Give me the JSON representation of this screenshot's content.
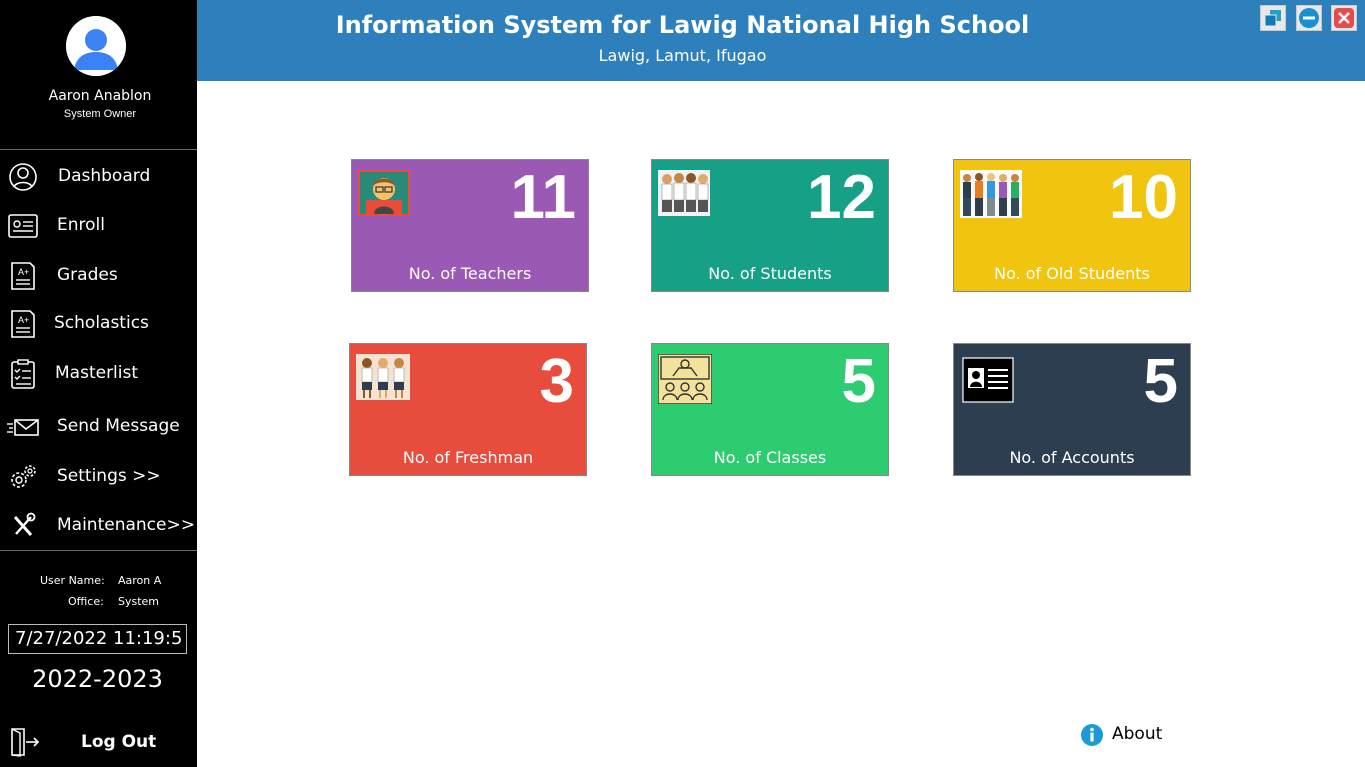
{
  "header": {
    "title": "Information System for Lawig National High School",
    "subtitle": "Lawig, Lamut, Ifugao"
  },
  "user": {
    "name": "Aaron Anablon",
    "role": "System Owner"
  },
  "nav": {
    "items": [
      {
        "label": "Dashboard",
        "icon": "dashboard-user-icon"
      },
      {
        "label": "Enroll",
        "icon": "id-card-icon"
      },
      {
        "label": "Grades",
        "icon": "grade-sheet-icon"
      },
      {
        "label": "Scholastics",
        "icon": "report-sheet-icon"
      },
      {
        "label": "Masterlist",
        "icon": "checklist-icon"
      },
      {
        "label": "Send Message",
        "icon": "envelope-icon"
      },
      {
        "label": "Settings >>",
        "icon": "gears-icon"
      },
      {
        "label": "Maintenance>>",
        "icon": "tools-icon"
      }
    ]
  },
  "session": {
    "username_label": "User Name:",
    "username_value": "Aaron A",
    "office_label": "Office:",
    "office_value": "System",
    "datetime": "7/27/2022 11:19:5",
    "school_year": "2022-2023"
  },
  "logout": {
    "label": "Log Out",
    "icon": "logout-door-icon"
  },
  "cards": [
    {
      "value": "11",
      "label": "No. of Teachers",
      "color": "#9b59b6",
      "icon": "teacher-icon"
    },
    {
      "value": "12",
      "label": "No. of Students",
      "color": "#16a085",
      "icon": "students-icon"
    },
    {
      "value": "10",
      "label": "No. of Old Students",
      "color": "#f1c40f",
      "icon": "old-students-icon"
    },
    {
      "value": "3",
      "label": "No. of Freshman",
      "color": "#e74c3c",
      "icon": "freshman-icon"
    },
    {
      "value": "5",
      "label": "No. of Classes",
      "color": "#2ecc71",
      "icon": "classroom-icon"
    },
    {
      "value": "5",
      "label": "No. of Accounts",
      "color": "#2c3e50",
      "icon": "account-card-icon"
    }
  ],
  "about": {
    "label": "About",
    "icon": "info-icon"
  },
  "window_controls": {
    "restore_icon": "restore-icon",
    "minimize_icon": "minimize-icon",
    "close_icon": "close-icon"
  },
  "colors": {
    "header": "#2e80bd",
    "sidebar": "#000000",
    "info_blue": "#1a9ad6",
    "close_red": "#e64a4a"
  }
}
